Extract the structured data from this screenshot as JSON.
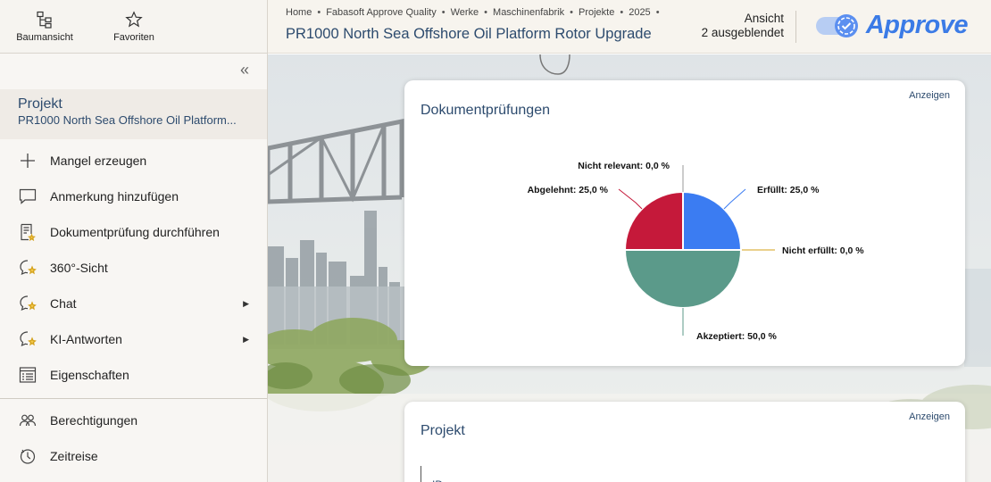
{
  "topnav": {
    "tree_label": "Baumansicht",
    "favorites_label": "Favoriten"
  },
  "project": {
    "label": "Projekt",
    "name": "PR1000 North Sea Offshore Oil Platform..."
  },
  "menu": {
    "items": [
      {
        "label": "Mangel erzeugen",
        "icon": "plus-icon"
      },
      {
        "label": "Anmerkung hinzufügen",
        "icon": "comment-icon"
      },
      {
        "label": "Dokumentprüfung durchführen",
        "icon": "document-check-icon"
      },
      {
        "label": "360°-Sicht",
        "icon": "ai-chat-icon"
      },
      {
        "label": "Chat",
        "icon": "ai-chat-icon"
      },
      {
        "label": "KI-Antworten",
        "icon": "ai-chat-icon"
      },
      {
        "label": "Eigenschaften",
        "icon": "properties-icon"
      },
      {
        "label": "Berechtigungen",
        "icon": "users-icon"
      },
      {
        "label": "Zeitreise",
        "icon": "history-icon"
      }
    ]
  },
  "breadcrumb": [
    "Home",
    "Fabasoft Approve Quality",
    "Werke",
    "Maschinenfabrik",
    "Projekte",
    "2025"
  ],
  "header": {
    "title": "PR1000 North Sea Offshore Oil Platform Rotor Upgrade",
    "view_label": "Ansicht",
    "hidden_label": "2 ausgeblendet",
    "brand": "Approve",
    "brand_color": "#3b7be6"
  },
  "card_documents": {
    "title": "Dokumentprüfungen",
    "link": "Anzeigen"
  },
  "card_project": {
    "title": "Projekt",
    "link": "Anzeigen",
    "id_label": "ID"
  },
  "chart_data": {
    "type": "pie",
    "slices": [
      {
        "name": "Erfüllt",
        "value": 25.0,
        "label": "Erfüllt: 25,0 %",
        "color": "#3b7cf2"
      },
      {
        "name": "Nicht erfüllt",
        "value": 0.0,
        "label": "Nicht erfüllt: 0,0 %",
        "color": "#d4a11a"
      },
      {
        "name": "Akzeptiert",
        "value": 50.0,
        "label": "Akzeptiert: 50,0 %",
        "color": "#5b9a8a"
      },
      {
        "name": "Abgelehnt",
        "value": 25.0,
        "label": "Abgelehnt: 25,0 %",
        "color": "#c5193a"
      },
      {
        "name": "Nicht relevant",
        "value": 0.0,
        "label": "Nicht relevant: 0,0 %",
        "color": "#9a9a9a"
      }
    ]
  }
}
